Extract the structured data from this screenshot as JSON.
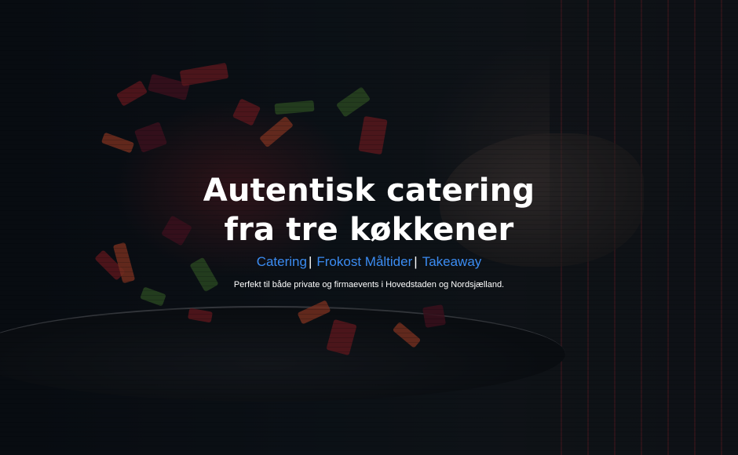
{
  "hero": {
    "headline_line1": "Autentisk catering",
    "headline_line2": "fra tre køkkener",
    "links": [
      {
        "label": "Catering"
      },
      {
        "label": "Frokost Måltider"
      },
      {
        "label": "Takeaway"
      }
    ],
    "separator": "|",
    "tagline": "Perfekt til både private og firmaevents i Hovedstaden og Nordsjælland.",
    "colors": {
      "link": "#3b8cf2",
      "text": "#ffffff",
      "background": "#0b0f14"
    }
  }
}
